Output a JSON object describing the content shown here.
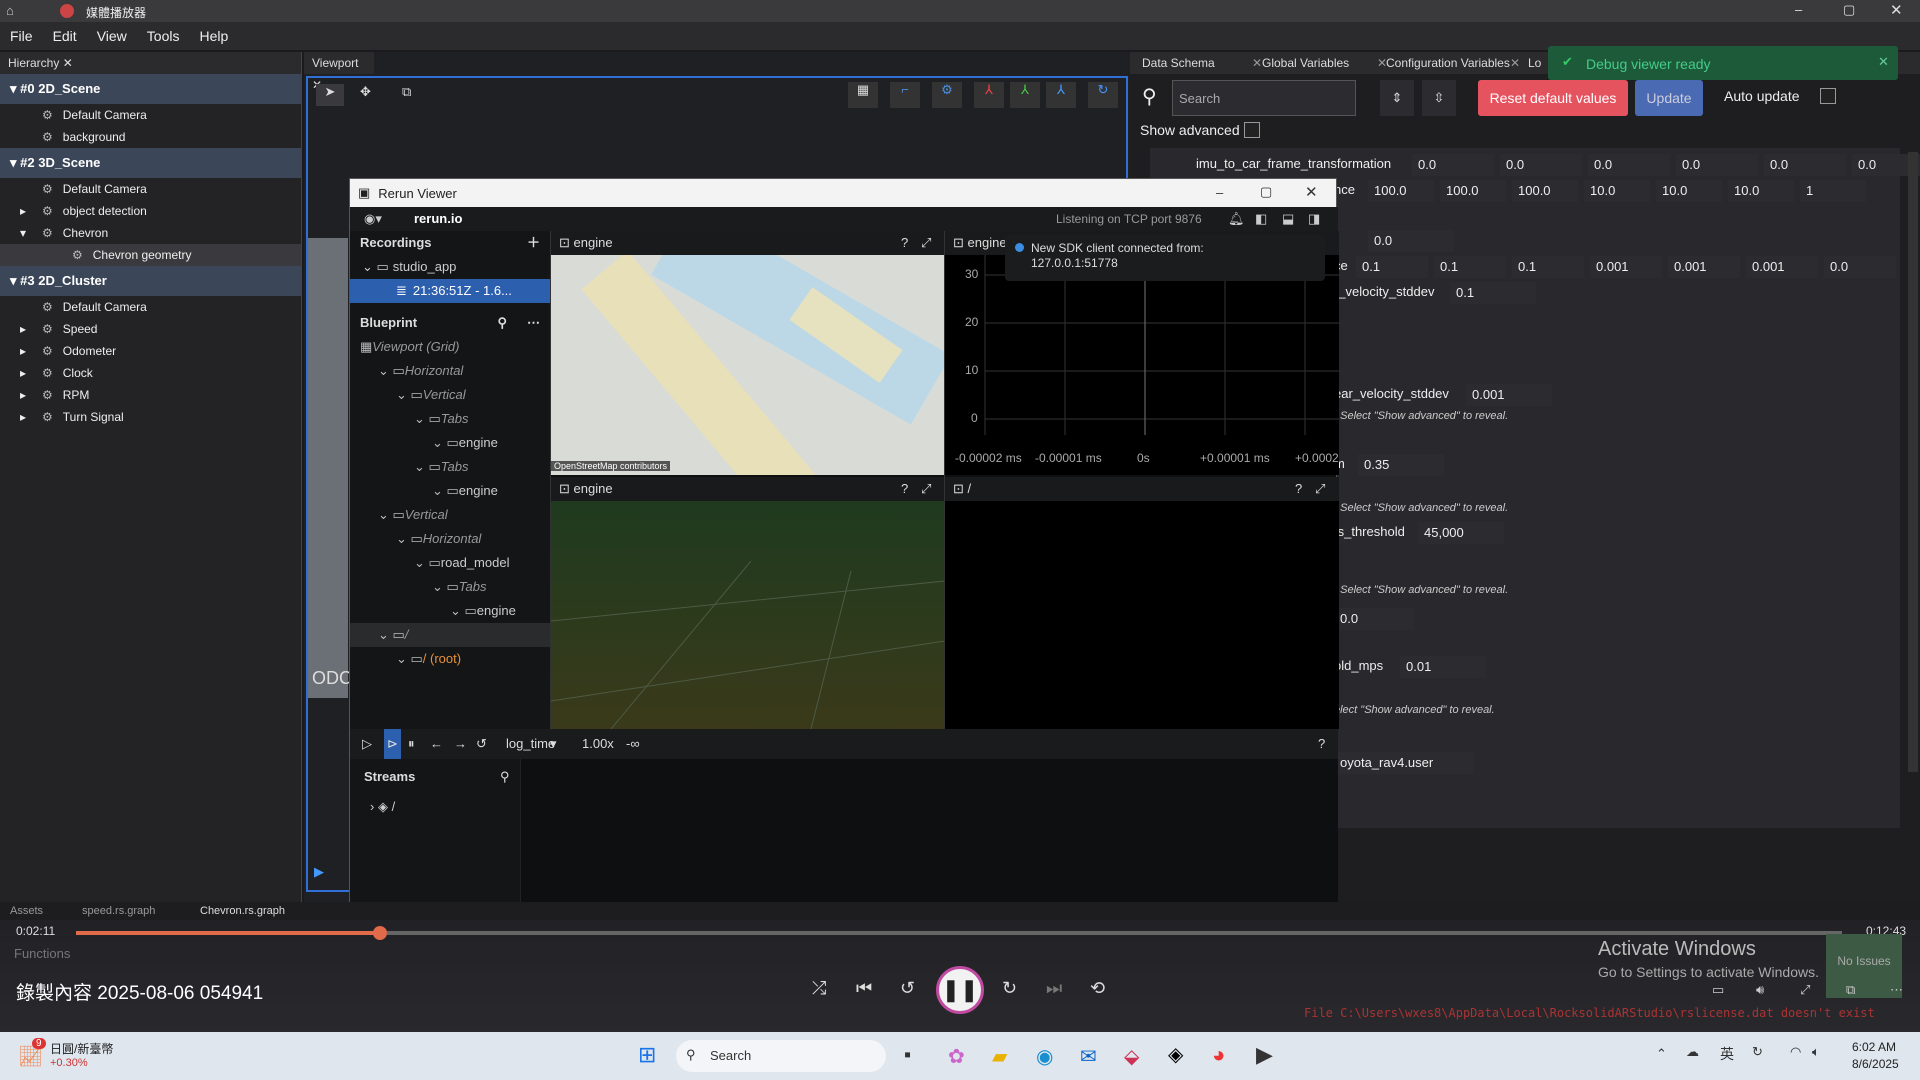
{
  "window": {
    "title": "媒體播放器"
  },
  "menu": [
    "File",
    "Edit",
    "View",
    "Tools",
    "Help"
  ],
  "hierarchy": {
    "tab": "Hierarchy",
    "groups": [
      {
        "name": "#0 2D_Scene",
        "items": [
          {
            "label": "Default Camera",
            "arrow": ""
          },
          {
            "label": "background",
            "arrow": ""
          }
        ]
      },
      {
        "name": "#2 3D_Scene",
        "items": [
          {
            "label": "Default Camera",
            "arrow": ""
          },
          {
            "label": "object detection",
            "arrow": "▸"
          },
          {
            "label": "Chevron",
            "arrow": "▾"
          },
          {
            "label": "Chevron geometry",
            "arrow": "",
            "sub": true
          }
        ]
      },
      {
        "name": "#3 2D_Cluster",
        "items": [
          {
            "label": "Default Camera",
            "arrow": ""
          },
          {
            "label": "Speed",
            "arrow": "▸"
          },
          {
            "label": "Odometer",
            "arrow": "▸"
          },
          {
            "label": "Clock",
            "arrow": "▸"
          },
          {
            "label": "RPM",
            "arrow": "▸"
          },
          {
            "label": "Turn Signal",
            "arrow": "▸"
          }
        ]
      }
    ]
  },
  "viewport": {
    "tab": "Viewport"
  },
  "right_tabs": [
    "Data Schema",
    "Global Variables",
    "Configuration Variables",
    "Lo"
  ],
  "toast": {
    "text": "Debug viewer ready"
  },
  "config": {
    "search_placeholder": "Search",
    "reset_label": "Reset default values",
    "update_label": "Update",
    "auto_update": "Auto update",
    "show_advanced": "Show advanced",
    "row1": {
      "label": "imu_to_car_frame_transformation",
      "values": [
        "0.0",
        "0.0",
        "0.0",
        "0.0",
        "0.0",
        "0.0"
      ]
    },
    "row2": {
      "label": "nce",
      "values": [
        "100.0",
        "100.0",
        "100.0",
        "10.0",
        "10.0",
        "10.0",
        "1"
      ]
    },
    "v_00": "0.0",
    "row3": {
      "label": "ce",
      "values": [
        "0.1",
        "0.1",
        "0.1",
        "0.001",
        "0.001",
        "0.001",
        "0.0"
      ]
    },
    "r_vel": {
      "label": "r_velocity_stddev",
      "value": "0.1"
    },
    "ear_vel": {
      "label": "ear_velocity_stddev",
      "value": "0.001"
    },
    "hint1": ". Select \"Show advanced\" to reveal.",
    "m": {
      "label": "m",
      "value": "0.35"
    },
    "hint2": ". Select \"Show advanced\" to reveal.",
    "ts": {
      "label": "ts_threshold",
      "value": "45,000"
    },
    "hint3": ". Select \"Show advanced\" to reveal.",
    "v_00b": "0.0",
    "old": {
      "label": "old_mps",
      "value": "0.01"
    },
    "hint4": "elect \"Show advanced\" to reveal.",
    "toyota": "oyota_rav4.user"
  },
  "rerun": {
    "title": "Rerun Viewer",
    "brand": "rerun.io",
    "listening": "Listening on TCP port 9876",
    "recordings_label": "Recordings",
    "app": "studio_app",
    "rec": "21:36:51Z - 1.6...",
    "blueprint_label": "Blueprint",
    "tree": [
      {
        "t": "Viewport (Grid)",
        "d": 0,
        "i": true
      },
      {
        "t": "Horizontal",
        "d": 1,
        "i": true
      },
      {
        "t": "Vertical",
        "d": 2,
        "i": true
      },
      {
        "t": "Tabs",
        "d": 3,
        "i": true
      },
      {
        "t": "engine",
        "d": 4,
        "i": false
      },
      {
        "t": "Tabs",
        "d": 3,
        "i": true
      },
      {
        "t": "engine",
        "d": 4,
        "i": false
      },
      {
        "t": "Vertical",
        "d": 1,
        "i": true
      },
      {
        "t": "Horizontal",
        "d": 2,
        "i": true
      },
      {
        "t": "road_model",
        "d": 3,
        "i": false
      },
      {
        "t": "Tabs",
        "d": 4,
        "i": true
      },
      {
        "t": "engine",
        "d": 5,
        "i": false
      },
      {
        "t": "/",
        "d": 1,
        "i": true
      },
      {
        "t": "/ (root)",
        "d": 2,
        "i": false
      }
    ],
    "view_engine": "engine",
    "map_credit": "OpenStreetMap contributors",
    "notification": {
      "line1": "New SDK client connected from:",
      "line2": "127.0.0.1:51778"
    },
    "plot_ticks_y": [
      "30",
      "20",
      "10",
      "0"
    ],
    "plot_ticks_x": [
      "-0.00002 ms",
      "-0.00001 ms",
      "0s",
      "+0.00001 ms",
      "+0.0002"
    ],
    "root_view": "/",
    "timeline": "log_time",
    "speed": "1.00x",
    "inf": "-∞",
    "streams": "Streams",
    "stream_root": "/"
  },
  "bottom_tabs": [
    "Assets",
    "speed.rs.graph",
    "Chevron.rs.graph"
  ],
  "functions": "Functions",
  "player": {
    "time": "0:02:11",
    "total": "0:12:43",
    "progress": 0.172,
    "recording_label": "錄製內容 2025-08-06 054941"
  },
  "activate": {
    "line1": "Activate Windows",
    "line2": "Go to Settings to activate Windows."
  },
  "console": "File C:\\Users\\wxes8\\AppData\\Local\\RocksolidARStudio\\rslicense.dat doesn't exist",
  "taskbar": {
    "weather": "日圓/新臺幣",
    "weather_change": "+0.30%",
    "badge": "9",
    "search": "Search",
    "lang": "英",
    "time": "6:02 AM",
    "date": "8/6/2025"
  },
  "odc": "ODC",
  "no_issues": "No Issues"
}
